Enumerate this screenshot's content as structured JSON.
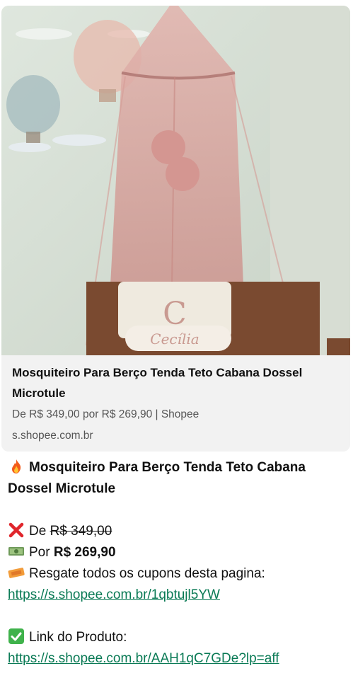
{
  "preview": {
    "image_alt": "Mosquiteiro rosa sobre berço",
    "bolster_text": "Cecília",
    "pillow_letter": "C",
    "title": "Mosquiteiro Para Berço Tenda Teto Cabana Dossel Microtule",
    "description": "De R$ 349,00 por R$ 269,90 | Shopee",
    "domain": "s.shopee.com.br"
  },
  "message": {
    "fire_icon": "fire-emoji",
    "title": "Mosquiteiro Para Berço Tenda Teto Cabana Dossel Microtule",
    "old_price_prefix": "De",
    "old_price": "R$ 349,00",
    "new_price_prefix": "Por",
    "new_price": "R$ 269,90",
    "coupon_text": "Resgate todos os cupons desta pagina:",
    "coupon_link": "https://s.shopee.com.br/1qbtujl5YW",
    "product_label": "Link do Produto:",
    "product_link": "https://s.shopee.com.br/AAH1qC7GDe?lp=aff"
  },
  "colors": {
    "link": "#0a7a55",
    "card_bg": "#f2f2f2",
    "canopy": "#d9a39e"
  }
}
